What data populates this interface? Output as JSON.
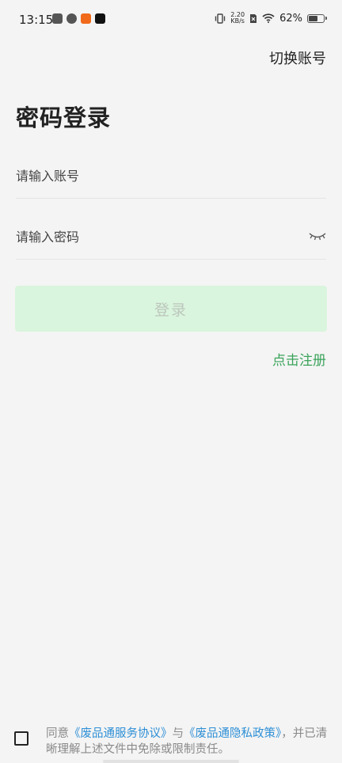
{
  "status_bar": {
    "time": "13:15",
    "net_speed_value": "2.20",
    "net_speed_unit": "KB/s",
    "battery_percent_text": "62%",
    "battery_level": 0.62,
    "icons_left": [
      "notification-icon",
      "link-app-icon",
      "taobao-icon",
      "tiktok-icon"
    ],
    "icons_right": [
      "vibrate-icon",
      "sim-off-icon",
      "wifi-icon",
      "battery-icon"
    ]
  },
  "header": {
    "switch_account": "切换账号"
  },
  "title": "密码登录",
  "form": {
    "account_placeholder": "请输入账号",
    "password_placeholder": "请输入密码",
    "login_label": "登录"
  },
  "register_link": "点击注册",
  "agreement": {
    "prefix": "同意",
    "service_link": "《废品通服务协议》",
    "connector": "与",
    "privacy_link": "《废品通隐私政策》",
    "suffix": "，并已清晰理解上述文件中免除或限制责任。"
  },
  "colors": {
    "background": "#f4f4f4",
    "button_bg": "#d9f5dd",
    "accent_green": "#3aa35a",
    "link_blue": "#2e8fd6"
  }
}
